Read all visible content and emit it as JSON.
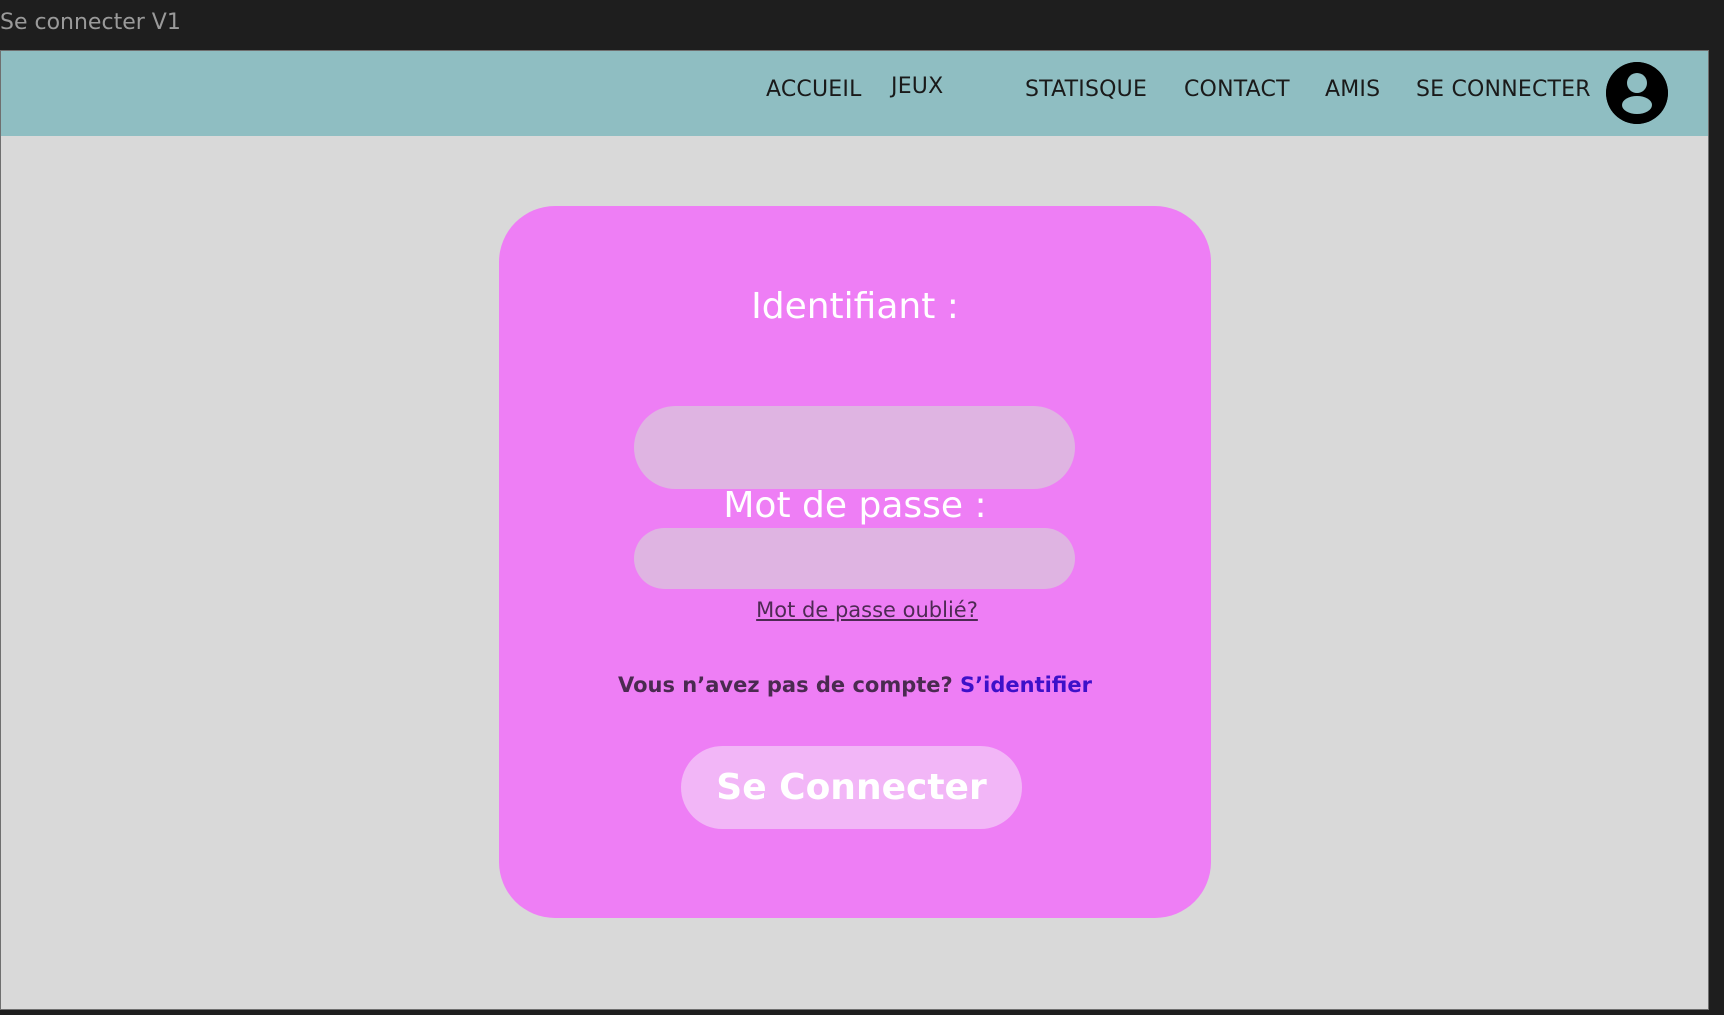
{
  "frame": {
    "title": "Se connecter V1"
  },
  "nav": {
    "items": [
      {
        "label": "ACCUEIL"
      },
      {
        "label": "JEUX"
      },
      {
        "label": "STATISQUE"
      },
      {
        "label": "CONTACT"
      },
      {
        "label": "AMIS"
      },
      {
        "label": "SE CONNECTER"
      }
    ],
    "avatar_icon": "user-avatar-icon"
  },
  "login": {
    "username_label": "Identifiant :",
    "username_value": "",
    "password_label": "Mot de passe :",
    "password_value": "",
    "forgot_password": "Mot de passe oublié?",
    "no_account_text": "Vous n’avez pas de compte?",
    "signup_link": "S’identifier",
    "submit_label": "Se Connecter"
  },
  "colors": {
    "navbar": "#8fbec2",
    "background": "#d9d9d9",
    "card": "#ee7ef5",
    "input": "#dfb4e2",
    "button": "#f2b6f7",
    "link": "#3d10c9"
  }
}
